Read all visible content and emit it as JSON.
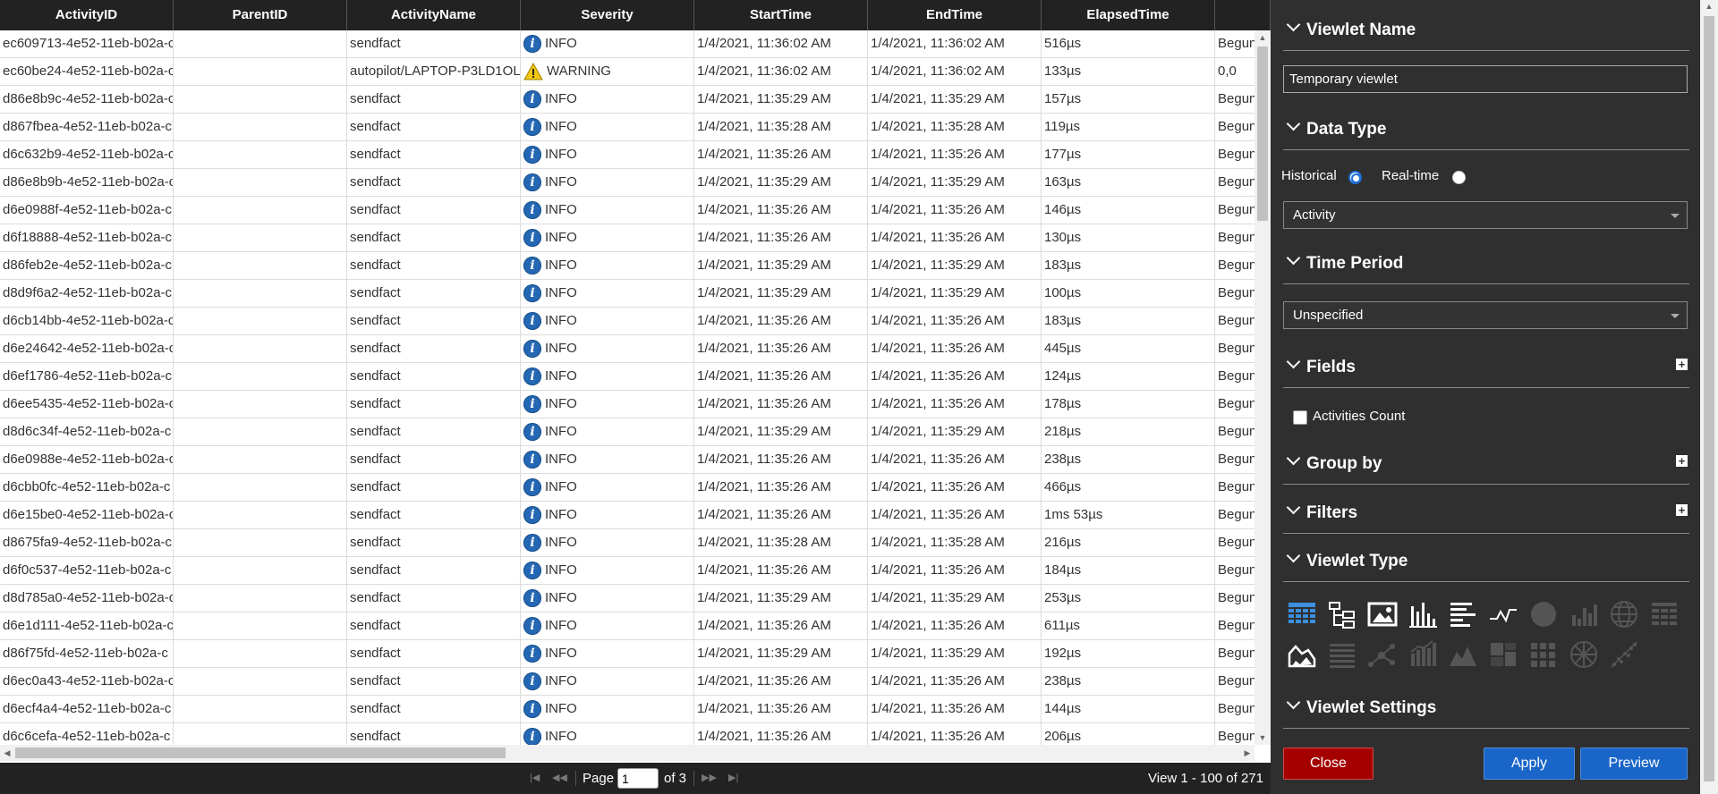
{
  "grid": {
    "columns": [
      "ActivityID",
      "ParentID",
      "ActivityName",
      "Severity",
      "StartTime",
      "EndTime",
      "ElapsedTime",
      ""
    ],
    "rows": [
      {
        "id": "ec609713-4e52-11eb-b02a-c",
        "parent": "",
        "name": "sendfact",
        "sev": "INFO",
        "start": "1/4/2021, 11:36:02 AM",
        "end": "1/4/2021, 11:36:02 AM",
        "elapsed": "516µs",
        "extra": "Begun"
      },
      {
        "id": "ec60be24-4e52-11eb-b02a-c",
        "parent": "",
        "name": "autopilot/LAPTOP-P3LD1OL",
        "sev": "WARNING",
        "start": "1/4/2021, 11:36:02 AM",
        "end": "1/4/2021, 11:36:02 AM",
        "elapsed": "133µs",
        "extra": "0,0"
      },
      {
        "id": "d86e8b9c-4e52-11eb-b02a-c",
        "parent": "",
        "name": "sendfact",
        "sev": "INFO",
        "start": "1/4/2021, 11:35:29 AM",
        "end": "1/4/2021, 11:35:29 AM",
        "elapsed": "157µs",
        "extra": "Begun"
      },
      {
        "id": "d867fbea-4e52-11eb-b02a-c",
        "parent": "",
        "name": "sendfact",
        "sev": "INFO",
        "start": "1/4/2021, 11:35:28 AM",
        "end": "1/4/2021, 11:35:28 AM",
        "elapsed": "119µs",
        "extra": "Begun"
      },
      {
        "id": "d6c632b9-4e52-11eb-b02a-c",
        "parent": "",
        "name": "sendfact",
        "sev": "INFO",
        "start": "1/4/2021, 11:35:26 AM",
        "end": "1/4/2021, 11:35:26 AM",
        "elapsed": "177µs",
        "extra": "Begun"
      },
      {
        "id": "d86e8b9b-4e52-11eb-b02a-c",
        "parent": "",
        "name": "sendfact",
        "sev": "INFO",
        "start": "1/4/2021, 11:35:29 AM",
        "end": "1/4/2021, 11:35:29 AM",
        "elapsed": "163µs",
        "extra": "Begun"
      },
      {
        "id": "d6e0988f-4e52-11eb-b02a-c",
        "parent": "",
        "name": "sendfact",
        "sev": "INFO",
        "start": "1/4/2021, 11:35:26 AM",
        "end": "1/4/2021, 11:35:26 AM",
        "elapsed": "146µs",
        "extra": "Begun"
      },
      {
        "id": "d6f18888-4e52-11eb-b02a-c",
        "parent": "",
        "name": "sendfact",
        "sev": "INFO",
        "start": "1/4/2021, 11:35:26 AM",
        "end": "1/4/2021, 11:35:26 AM",
        "elapsed": "130µs",
        "extra": "Begun"
      },
      {
        "id": "d86feb2e-4e52-11eb-b02a-c",
        "parent": "",
        "name": "sendfact",
        "sev": "INFO",
        "start": "1/4/2021, 11:35:29 AM",
        "end": "1/4/2021, 11:35:29 AM",
        "elapsed": "183µs",
        "extra": "Begun"
      },
      {
        "id": "d8d9f6a2-4e52-11eb-b02a-c",
        "parent": "",
        "name": "sendfact",
        "sev": "INFO",
        "start": "1/4/2021, 11:35:29 AM",
        "end": "1/4/2021, 11:35:29 AM",
        "elapsed": "100µs",
        "extra": "Begun"
      },
      {
        "id": "d6cb14bb-4e52-11eb-b02a-c",
        "parent": "",
        "name": "sendfact",
        "sev": "INFO",
        "start": "1/4/2021, 11:35:26 AM",
        "end": "1/4/2021, 11:35:26 AM",
        "elapsed": "183µs",
        "extra": "Begun"
      },
      {
        "id": "d6e24642-4e52-11eb-b02a-c",
        "parent": "",
        "name": "sendfact",
        "sev": "INFO",
        "start": "1/4/2021, 11:35:26 AM",
        "end": "1/4/2021, 11:35:26 AM",
        "elapsed": "445µs",
        "extra": "Begun"
      },
      {
        "id": "d6ef1786-4e52-11eb-b02a-c",
        "parent": "",
        "name": "sendfact",
        "sev": "INFO",
        "start": "1/4/2021, 11:35:26 AM",
        "end": "1/4/2021, 11:35:26 AM",
        "elapsed": "124µs",
        "extra": "Begun"
      },
      {
        "id": "d6ee5435-4e52-11eb-b02a-c",
        "parent": "",
        "name": "sendfact",
        "sev": "INFO",
        "start": "1/4/2021, 11:35:26 AM",
        "end": "1/4/2021, 11:35:26 AM",
        "elapsed": "178µs",
        "extra": "Begun"
      },
      {
        "id": "d8d6c34f-4e52-11eb-b02a-c",
        "parent": "",
        "name": "sendfact",
        "sev": "INFO",
        "start": "1/4/2021, 11:35:29 AM",
        "end": "1/4/2021, 11:35:29 AM",
        "elapsed": "218µs",
        "extra": "Begun"
      },
      {
        "id": "d6e0988e-4e52-11eb-b02a-c",
        "parent": "",
        "name": "sendfact",
        "sev": "INFO",
        "start": "1/4/2021, 11:35:26 AM",
        "end": "1/4/2021, 11:35:26 AM",
        "elapsed": "238µs",
        "extra": "Begun"
      },
      {
        "id": "d6cbb0fc-4e52-11eb-b02a-c",
        "parent": "",
        "name": "sendfact",
        "sev": "INFO",
        "start": "1/4/2021, 11:35:26 AM",
        "end": "1/4/2021, 11:35:26 AM",
        "elapsed": "466µs",
        "extra": "Begun"
      },
      {
        "id": "d6e15be0-4e52-11eb-b02a-c",
        "parent": "",
        "name": "sendfact",
        "sev": "INFO",
        "start": "1/4/2021, 11:35:26 AM",
        "end": "1/4/2021, 11:35:26 AM",
        "elapsed": "1ms 53µs",
        "extra": "Begun"
      },
      {
        "id": "d8675fa9-4e52-11eb-b02a-c",
        "parent": "",
        "name": "sendfact",
        "sev": "INFO",
        "start": "1/4/2021, 11:35:28 AM",
        "end": "1/4/2021, 11:35:28 AM",
        "elapsed": "216µs",
        "extra": "Begun"
      },
      {
        "id": "d6f0c537-4e52-11eb-b02a-c",
        "parent": "",
        "name": "sendfact",
        "sev": "INFO",
        "start": "1/4/2021, 11:35:26 AM",
        "end": "1/4/2021, 11:35:26 AM",
        "elapsed": "184µs",
        "extra": "Begun"
      },
      {
        "id": "d8d785a0-4e52-11eb-b02a-c",
        "parent": "",
        "name": "sendfact",
        "sev": "INFO",
        "start": "1/4/2021, 11:35:29 AM",
        "end": "1/4/2021, 11:35:29 AM",
        "elapsed": "253µs",
        "extra": "Begun"
      },
      {
        "id": "d6e1d111-4e52-11eb-b02a-c",
        "parent": "",
        "name": "sendfact",
        "sev": "INFO",
        "start": "1/4/2021, 11:35:26 AM",
        "end": "1/4/2021, 11:35:26 AM",
        "elapsed": "611µs",
        "extra": "Begun"
      },
      {
        "id": "d86f75fd-4e52-11eb-b02a-c",
        "parent": "",
        "name": "sendfact",
        "sev": "INFO",
        "start": "1/4/2021, 11:35:29 AM",
        "end": "1/4/2021, 11:35:29 AM",
        "elapsed": "192µs",
        "extra": "Begun"
      },
      {
        "id": "d6ec0a43-4e52-11eb-b02a-c",
        "parent": "",
        "name": "sendfact",
        "sev": "INFO",
        "start": "1/4/2021, 11:35:26 AM",
        "end": "1/4/2021, 11:35:26 AM",
        "elapsed": "238µs",
        "extra": "Begun"
      },
      {
        "id": "d6ecf4a4-4e52-11eb-b02a-c",
        "parent": "",
        "name": "sendfact",
        "sev": "INFO",
        "start": "1/4/2021, 11:35:26 AM",
        "end": "1/4/2021, 11:35:26 AM",
        "elapsed": "144µs",
        "extra": "Begun"
      },
      {
        "id": "d6c6cefa-4e52-11eb-b02a-c",
        "parent": "",
        "name": "sendfact",
        "sev": "INFO",
        "start": "1/4/2021, 11:35:26 AM",
        "end": "1/4/2021, 11:35:26 AM",
        "elapsed": "206µs",
        "extra": "Begun"
      }
    ]
  },
  "pager": {
    "page_label": "Page",
    "page_value": "1",
    "of_label": "of 3",
    "view_info": "View 1 - 100 of 271"
  },
  "panel": {
    "sections": {
      "viewlet_name": "Viewlet Name",
      "data_type": "Data Type",
      "time_period": "Time Period",
      "fields": "Fields",
      "group_by": "Group by",
      "filters": "Filters",
      "viewlet_type": "Viewlet Type",
      "viewlet_settings": "Viewlet Settings"
    },
    "viewlet_name_value": "Temporary viewlet",
    "historical_label": "Historical",
    "realtime_label": "Real-time",
    "data_type_selected": "Activity",
    "time_period_selected": "Unspecified",
    "field_activities_count": "Activities Count",
    "buttons": {
      "close": "Close",
      "apply": "Apply",
      "preview": "Preview"
    },
    "viewlet_types": [
      "table-icon",
      "tree-icon",
      "image-icon",
      "bar-chart-icon",
      "horizontal-bar-icon",
      "line-chart-icon",
      "pie-chart-icon",
      "column-chart-icon",
      "globe-icon",
      "heatmap-icon",
      "area-chart-icon",
      "list-icon",
      "scatter-icon",
      "stacked-column-icon",
      "mountain-icon",
      "treemap-icon",
      "grid-icon",
      "sphere-icon",
      "scatter-plot-icon"
    ]
  },
  "colors": {
    "header_bg": "#222222",
    "panel_bg": "#2f2f2f",
    "info_blue": "#2467b3",
    "warning_yellow": "#f2c811",
    "close_red": "#a40000",
    "apply_blue": "#1a66c8",
    "active_icon": "#3b8fe0"
  }
}
